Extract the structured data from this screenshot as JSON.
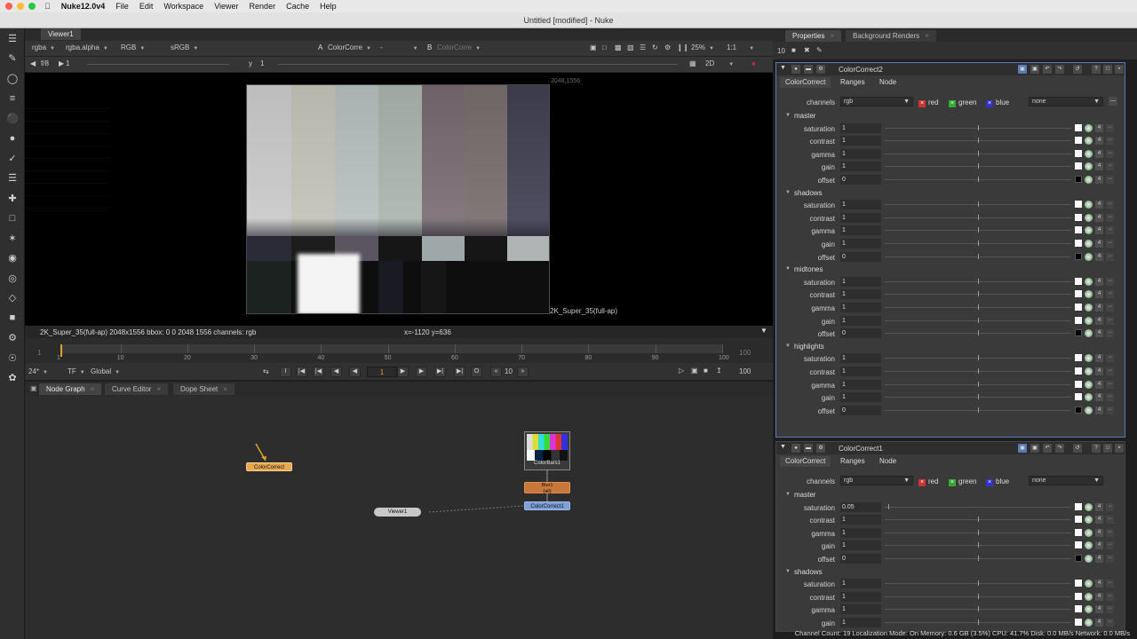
{
  "menubar": {
    "app": "Nuke12.0v4",
    "items": [
      "File",
      "Edit",
      "Workspace",
      "Viewer",
      "Render",
      "Cache",
      "Help"
    ],
    "traffic": [
      "#fe5f57",
      "#febc2e",
      "#28c840"
    ]
  },
  "window_title": "Untitled [modified] - Nuke",
  "viewer": {
    "tab": "Viewer1",
    "channels": "rgba",
    "alpha": "rgba.alpha",
    "display": "RGB",
    "colorspace": "sRGB",
    "input_a_label": "A",
    "input_a": "ColorCorre",
    "input_a_op": "-",
    "input_b_label": "B",
    "input_b": "ColorCorre",
    "zoom": "25%",
    "ratio": "1:1",
    "frame_label": "f/8",
    "frame_value": "1",
    "y_label": "y",
    "y_value": "1",
    "view_mode": "2D",
    "format_top": "2048,1556",
    "format_label": "2K_Super_35(full-ap)",
    "info": "2K_Super_35(full-ap) 2048x1556  bbox: 0 0 2048 1556 channels: rgb",
    "coords": "x=-1120 y=636"
  },
  "timeline": {
    "ticks": [
      "1",
      "10",
      "20",
      "30",
      "40",
      "50",
      "60",
      "70",
      "80",
      "90",
      "100"
    ],
    "start": "1",
    "end": "100",
    "fps": "24*",
    "tf": "TF",
    "range": "Global",
    "current_frame": "1",
    "skip": "10",
    "end_frame": "100"
  },
  "nodegraph": {
    "tabs": [
      "Node Graph",
      "Curve Editor",
      "Dope Sheet"
    ],
    "nodes": {
      "colorcorrect_floating": "ColorCorrect",
      "viewer": "Viewer1",
      "colorbars": "ColorBars1",
      "blur": "Blur1",
      "blur_sub": "(all)",
      "colorcorrect1": "ColorCorrect1"
    }
  },
  "properties": {
    "tabs": [
      "Properties",
      "Background Renders"
    ],
    "max_panels": "10",
    "panel1": {
      "title": "ColorCorrect2",
      "tabs": [
        "ColorCorrect",
        "Ranges",
        "Node"
      ],
      "channels_label": "channels",
      "channels_value": "rgb",
      "red": "red",
      "green": "green",
      "blue": "blue",
      "none": "none",
      "sections": [
        {
          "name": "master",
          "rows": [
            {
              "label": "saturation",
              "value": "1"
            },
            {
              "label": "contrast",
              "value": "1"
            },
            {
              "label": "gamma",
              "value": "1"
            },
            {
              "label": "gain",
              "value": "1"
            },
            {
              "label": "offset",
              "value": "0"
            }
          ]
        },
        {
          "name": "shadows",
          "rows": [
            {
              "label": "saturation",
              "value": "1"
            },
            {
              "label": "contrast",
              "value": "1"
            },
            {
              "label": "gamma",
              "value": "1"
            },
            {
              "label": "gain",
              "value": "1"
            },
            {
              "label": "offset",
              "value": "0"
            }
          ]
        },
        {
          "name": "midtones",
          "rows": [
            {
              "label": "saturation",
              "value": "1"
            },
            {
              "label": "contrast",
              "value": "1"
            },
            {
              "label": "gamma",
              "value": "1"
            },
            {
              "label": "gain",
              "value": "1"
            },
            {
              "label": "offset",
              "value": "0"
            }
          ]
        },
        {
          "name": "highlights",
          "rows": [
            {
              "label": "saturation",
              "value": "1"
            },
            {
              "label": "contrast",
              "value": "1"
            },
            {
              "label": "gamma",
              "value": "1"
            },
            {
              "label": "gain",
              "value": "1"
            },
            {
              "label": "offset",
              "value": "0"
            }
          ]
        }
      ]
    },
    "panel2": {
      "title": "ColorCorrect1",
      "tabs": [
        "ColorCorrect",
        "Ranges",
        "Node"
      ],
      "channels_label": "channels",
      "channels_value": "rgb",
      "red": "red",
      "green": "green",
      "blue": "blue",
      "none": "none",
      "sections": [
        {
          "name": "master",
          "rows": [
            {
              "label": "saturation",
              "value": "0.05"
            },
            {
              "label": "contrast",
              "value": "1"
            },
            {
              "label": "gamma",
              "value": "1"
            },
            {
              "label": "gain",
              "value": "1"
            },
            {
              "label": "offset",
              "value": "0"
            }
          ]
        },
        {
          "name": "shadows",
          "rows": [
            {
              "label": "saturation",
              "value": "1"
            },
            {
              "label": "contrast",
              "value": "1"
            },
            {
              "label": "gamma",
              "value": "1"
            },
            {
              "label": "gain",
              "value": "1"
            }
          ]
        }
      ]
    }
  },
  "status": "Channel Count: 19  Localization Mode: On  Memory: 0.6 GB (3.5%)  CPU: 41.7%  Disk: 0.0 MB/s  Network: 0.0 MB/s",
  "colors": {
    "node_colorcorrect": "#e8a850",
    "node_blur": "#c8783a",
    "node_cc1": "#7f9fd8",
    "panel_border": "#5a78b4"
  }
}
